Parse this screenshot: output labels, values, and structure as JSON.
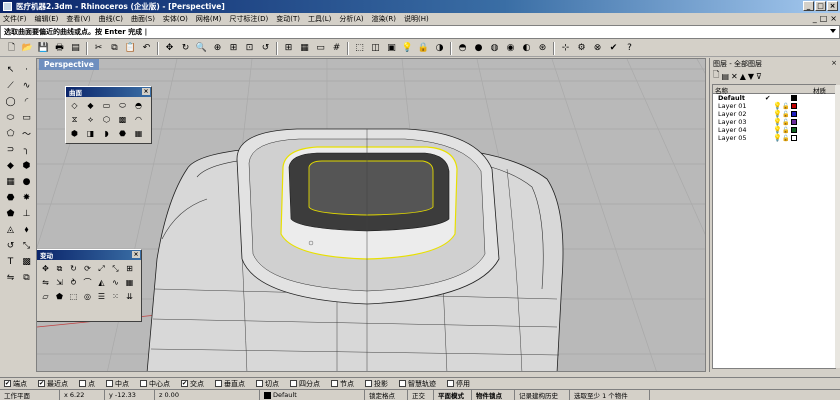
{
  "window": {
    "title": "医疗机器2.3dm - Rhinoceros (企业版) - [Perspective]",
    "controls": [
      "_",
      "□",
      "×"
    ]
  },
  "menu": {
    "items": [
      "文件(F)",
      "编辑(E)",
      "查看(V)",
      "曲线(C)",
      "曲面(S)",
      "实体(O)",
      "网格(M)",
      "尺寸标注(D)",
      "变动(T)",
      "工具(L)",
      "分析(A)",
      "渲染(R)",
      "说明(H)"
    ],
    "child_controls": [
      "_",
      "□",
      "×"
    ]
  },
  "command": {
    "prompt": "选取曲面要偏近的曲线或点。按 Enter 完成 |"
  },
  "viewport": {
    "label": "Perspective"
  },
  "panels": {
    "surface": {
      "title": "曲面",
      "close": "×"
    },
    "transform": {
      "title": "变动",
      "close": "×"
    }
  },
  "layers": {
    "title": "图层 - 全部图层",
    "close": "×",
    "col_name": "名称",
    "col_material": "材质",
    "rows": [
      {
        "name": "Default",
        "current": "✔",
        "color": "#000000"
      },
      {
        "name": "Layer 01",
        "current": "",
        "color": "#c00000"
      },
      {
        "name": "Layer 02",
        "current": "",
        "color": "#2020c0"
      },
      {
        "name": "Layer 03",
        "current": "",
        "color": "#6a2a9a"
      },
      {
        "name": "Layer 04",
        "current": "",
        "color": "#106020"
      },
      {
        "name": "Layer 05",
        "current": "",
        "color": "#ffffff"
      }
    ]
  },
  "osnap": [
    {
      "label": "端点",
      "checked": true
    },
    {
      "label": "最近点",
      "checked": true
    },
    {
      "label": "点",
      "checked": false
    },
    {
      "label": "中点",
      "checked": false
    },
    {
      "label": "中心点",
      "checked": false
    },
    {
      "label": "交点",
      "checked": true
    },
    {
      "label": "垂直点",
      "checked": false
    },
    {
      "label": "切点",
      "checked": false
    },
    {
      "label": "四分点",
      "checked": false
    },
    {
      "label": "节点",
      "checked": false
    },
    {
      "label": "投影",
      "checked": false
    },
    {
      "label": "智慧轨迹",
      "checked": false
    },
    {
      "label": "停用",
      "checked": false
    }
  ],
  "status": {
    "plane": "工作平面",
    "x": "x 6.22",
    "y": "y -12.33",
    "z": "z 0.00",
    "layer": "Default",
    "grid_snap": "锁定格点",
    "ortho": "正交",
    "planar": "平面模式",
    "osnap": "物件锁点",
    "history": "记录建构历史",
    "selection": "选取至少 1 个物件"
  }
}
